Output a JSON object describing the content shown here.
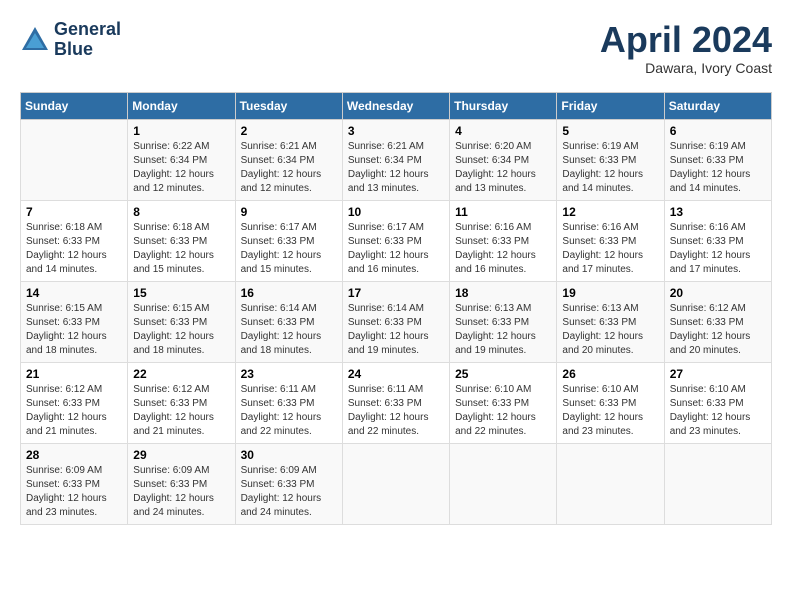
{
  "header": {
    "logo_line1": "General",
    "logo_line2": "Blue",
    "month": "April 2024",
    "location": "Dawara, Ivory Coast"
  },
  "weekdays": [
    "Sunday",
    "Monday",
    "Tuesday",
    "Wednesday",
    "Thursday",
    "Friday",
    "Saturday"
  ],
  "weeks": [
    [
      {
        "day": "",
        "info": ""
      },
      {
        "day": "1",
        "info": "Sunrise: 6:22 AM\nSunset: 6:34 PM\nDaylight: 12 hours\nand 12 minutes."
      },
      {
        "day": "2",
        "info": "Sunrise: 6:21 AM\nSunset: 6:34 PM\nDaylight: 12 hours\nand 12 minutes."
      },
      {
        "day": "3",
        "info": "Sunrise: 6:21 AM\nSunset: 6:34 PM\nDaylight: 12 hours\nand 13 minutes."
      },
      {
        "day": "4",
        "info": "Sunrise: 6:20 AM\nSunset: 6:34 PM\nDaylight: 12 hours\nand 13 minutes."
      },
      {
        "day": "5",
        "info": "Sunrise: 6:19 AM\nSunset: 6:33 PM\nDaylight: 12 hours\nand 14 minutes."
      },
      {
        "day": "6",
        "info": "Sunrise: 6:19 AM\nSunset: 6:33 PM\nDaylight: 12 hours\nand 14 minutes."
      }
    ],
    [
      {
        "day": "7",
        "info": "Sunrise: 6:18 AM\nSunset: 6:33 PM\nDaylight: 12 hours\nand 14 minutes."
      },
      {
        "day": "8",
        "info": "Sunrise: 6:18 AM\nSunset: 6:33 PM\nDaylight: 12 hours\nand 15 minutes."
      },
      {
        "day": "9",
        "info": "Sunrise: 6:17 AM\nSunset: 6:33 PM\nDaylight: 12 hours\nand 15 minutes."
      },
      {
        "day": "10",
        "info": "Sunrise: 6:17 AM\nSunset: 6:33 PM\nDaylight: 12 hours\nand 16 minutes."
      },
      {
        "day": "11",
        "info": "Sunrise: 6:16 AM\nSunset: 6:33 PM\nDaylight: 12 hours\nand 16 minutes."
      },
      {
        "day": "12",
        "info": "Sunrise: 6:16 AM\nSunset: 6:33 PM\nDaylight: 12 hours\nand 17 minutes."
      },
      {
        "day": "13",
        "info": "Sunrise: 6:16 AM\nSunset: 6:33 PM\nDaylight: 12 hours\nand 17 minutes."
      }
    ],
    [
      {
        "day": "14",
        "info": "Sunrise: 6:15 AM\nSunset: 6:33 PM\nDaylight: 12 hours\nand 18 minutes."
      },
      {
        "day": "15",
        "info": "Sunrise: 6:15 AM\nSunset: 6:33 PM\nDaylight: 12 hours\nand 18 minutes."
      },
      {
        "day": "16",
        "info": "Sunrise: 6:14 AM\nSunset: 6:33 PM\nDaylight: 12 hours\nand 18 minutes."
      },
      {
        "day": "17",
        "info": "Sunrise: 6:14 AM\nSunset: 6:33 PM\nDaylight: 12 hours\nand 19 minutes."
      },
      {
        "day": "18",
        "info": "Sunrise: 6:13 AM\nSunset: 6:33 PM\nDaylight: 12 hours\nand 19 minutes."
      },
      {
        "day": "19",
        "info": "Sunrise: 6:13 AM\nSunset: 6:33 PM\nDaylight: 12 hours\nand 20 minutes."
      },
      {
        "day": "20",
        "info": "Sunrise: 6:12 AM\nSunset: 6:33 PM\nDaylight: 12 hours\nand 20 minutes."
      }
    ],
    [
      {
        "day": "21",
        "info": "Sunrise: 6:12 AM\nSunset: 6:33 PM\nDaylight: 12 hours\nand 21 minutes."
      },
      {
        "day": "22",
        "info": "Sunrise: 6:12 AM\nSunset: 6:33 PM\nDaylight: 12 hours\nand 21 minutes."
      },
      {
        "day": "23",
        "info": "Sunrise: 6:11 AM\nSunset: 6:33 PM\nDaylight: 12 hours\nand 22 minutes."
      },
      {
        "day": "24",
        "info": "Sunrise: 6:11 AM\nSunset: 6:33 PM\nDaylight: 12 hours\nand 22 minutes."
      },
      {
        "day": "25",
        "info": "Sunrise: 6:10 AM\nSunset: 6:33 PM\nDaylight: 12 hours\nand 22 minutes."
      },
      {
        "day": "26",
        "info": "Sunrise: 6:10 AM\nSunset: 6:33 PM\nDaylight: 12 hours\nand 23 minutes."
      },
      {
        "day": "27",
        "info": "Sunrise: 6:10 AM\nSunset: 6:33 PM\nDaylight: 12 hours\nand 23 minutes."
      }
    ],
    [
      {
        "day": "28",
        "info": "Sunrise: 6:09 AM\nSunset: 6:33 PM\nDaylight: 12 hours\nand 23 minutes."
      },
      {
        "day": "29",
        "info": "Sunrise: 6:09 AM\nSunset: 6:33 PM\nDaylight: 12 hours\nand 24 minutes."
      },
      {
        "day": "30",
        "info": "Sunrise: 6:09 AM\nSunset: 6:33 PM\nDaylight: 12 hours\nand 24 minutes."
      },
      {
        "day": "",
        "info": ""
      },
      {
        "day": "",
        "info": ""
      },
      {
        "day": "",
        "info": ""
      },
      {
        "day": "",
        "info": ""
      }
    ]
  ]
}
